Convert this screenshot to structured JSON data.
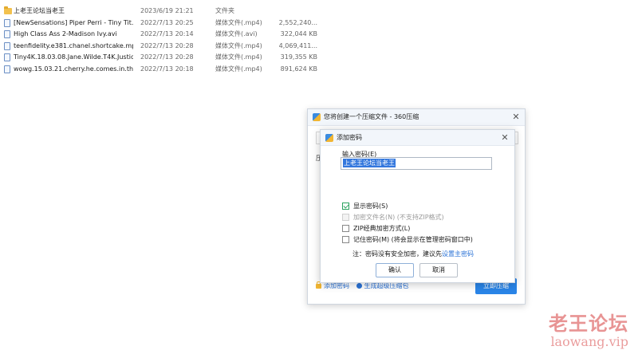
{
  "files": [
    {
      "name": "上老王论坛当老王",
      "date": "2023/6/19 21:21",
      "type": "文件夹",
      "size": "",
      "icon": "folder-icon"
    },
    {
      "name": "[NewSensations] Piper Perri - Tiny Tit...",
      "date": "2022/7/13 20:25",
      "type": "媒体文件(.mp4)",
      "size": "2,552,240...",
      "icon": "video-file-icon"
    },
    {
      "name": "High Class Ass 2-Madison Ivy.avi",
      "date": "2022/7/13 20:14",
      "type": "媒体文件(.avi)",
      "size": "322,044 KB",
      "icon": "video-file-icon"
    },
    {
      "name": "teenfidelity.e381.chanel.shortcake.mp4",
      "date": "2022/7/13 20:28",
      "type": "媒体文件(.mp4)",
      "size": "4,069,411...",
      "icon": "video-file-icon"
    },
    {
      "name": "Tiny4K.18.03.08.Jane.Wilde.T4K.Justic...",
      "date": "2022/7/13 20:28",
      "type": "媒体文件(.mp4)",
      "size": "319,355 KB",
      "icon": "video-file-icon"
    },
    {
      "name": "wowg.15.03.21.cherry.he.comes.in.the...",
      "date": "2022/7/13 20:18",
      "type": "媒体文件(.mp4)",
      "size": "891,624 KB",
      "icon": "video-file-icon"
    }
  ],
  "outer_dialog": {
    "title": "您将创建一个压缩文件 - 360压缩",
    "partial_label": "压",
    "add_password_link": "添加密码",
    "super_compress_link": "生成超级压缩包",
    "compress_button": "立即压缩"
  },
  "password_dialog": {
    "title": "添加密码",
    "input_label": "输入密码(E)",
    "password_value": "上老王论坛当老王",
    "options": [
      {
        "label": "显示密码(S)",
        "checked": true,
        "disabled": false
      },
      {
        "label": "加密文件名(N) (不支持ZIP格式)",
        "checked": false,
        "disabled": true
      },
      {
        "label": "ZIP经典加密方式(L)",
        "checked": false,
        "disabled": false
      },
      {
        "label": "记住密码(M) (将会显示在管理密码窗口中)",
        "checked": false,
        "disabled": false
      }
    ],
    "note_prefix": "注：密码没有安全加密，建议先",
    "note_link": "设置主密码",
    "ok_button": "确认",
    "cancel_button": "取消"
  },
  "watermark": {
    "cn": "老王论坛",
    "en": "laowang.vip"
  },
  "colors": {
    "accent": "#2a85e8",
    "link": "#2a72d6",
    "watermark": "#dc5a5a"
  }
}
